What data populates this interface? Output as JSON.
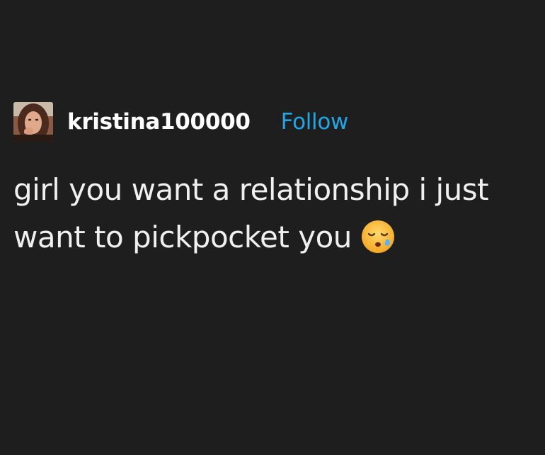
{
  "post": {
    "author": {
      "username": "kristina100000",
      "avatar_icon": "profile-photo"
    },
    "follow_label": "Follow",
    "text": "girl you want a relationship i just want to pickpocket you",
    "emoji_icon": "sleepy-face-icon"
  },
  "colors": {
    "background": "#1e1e1e",
    "text": "#f0f0f0",
    "follow": "#22a6e8"
  }
}
